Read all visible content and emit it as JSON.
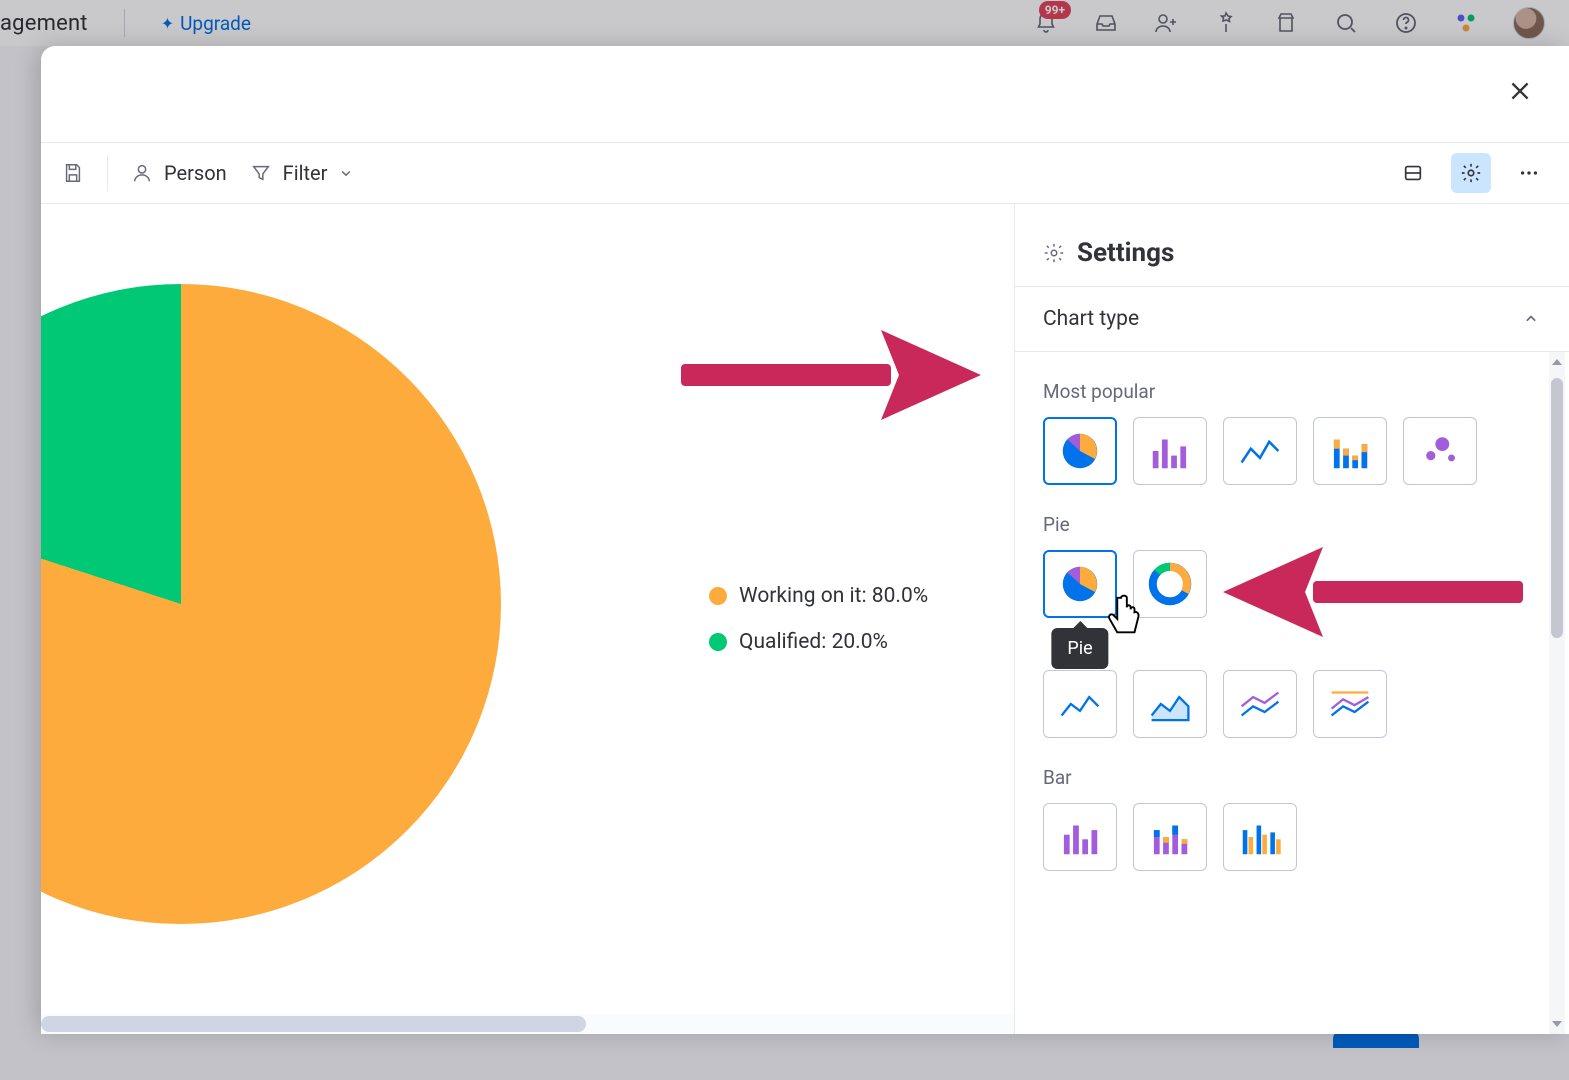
{
  "topbar": {
    "breadcrumb_fragment": "agement",
    "upgrade_label": "Upgrade",
    "notification_badge": "99+"
  },
  "toolbar": {
    "person_label": "Person",
    "filter_label": "Filter"
  },
  "settings": {
    "title": "Settings",
    "chart_type_label": "Chart type",
    "group_most_popular": "Most popular",
    "group_pie": "Pie",
    "group_bar": "Bar",
    "tooltip_pie": "Pie"
  },
  "chart_data": {
    "type": "pie",
    "series": [
      {
        "name": "Working on it",
        "value": 80.0,
        "color": "#fdab3d"
      },
      {
        "name": "Qualified",
        "value": 20.0,
        "color": "#00c875"
      }
    ],
    "legend": [
      "Working on it: 80.0%",
      "Qualified: 20.0%"
    ]
  }
}
